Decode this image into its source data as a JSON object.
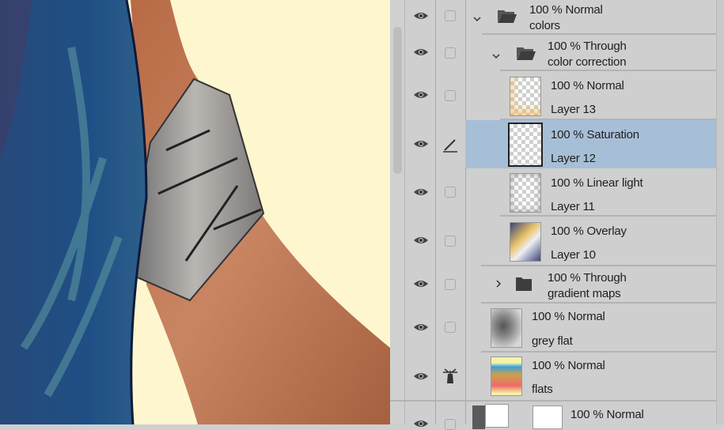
{
  "colors": {
    "selected_row": "#a7bfd6",
    "panel_bg": "#cfcfcf",
    "canvas_bg": "#fdf6cf"
  },
  "layers": [
    {
      "kind": "folder",
      "expanded": true,
      "blend": "100 % Normal",
      "name": "colors",
      "visible": true
    },
    {
      "kind": "folder",
      "expanded": true,
      "blend": "100 % Through",
      "name": "color correction",
      "visible": true
    },
    {
      "kind": "layer",
      "blend": "100 % Normal",
      "name": "Layer 13",
      "visible": true
    },
    {
      "kind": "layer",
      "blend": "100 % Saturation",
      "name": "Layer 12",
      "visible": true,
      "selected": true,
      "status_icon": "pen-icon"
    },
    {
      "kind": "layer",
      "blend": "100 % Linear light",
      "name": "Layer 11",
      "visible": true
    },
    {
      "kind": "layer",
      "blend": "100 % Overlay",
      "name": "Layer 10",
      "visible": true
    },
    {
      "kind": "folder",
      "expanded": false,
      "blend": "100 % Through",
      "name": "gradient maps",
      "visible": true
    },
    {
      "kind": "layer",
      "blend": "100 % Normal",
      "name": "grey flat",
      "visible": true
    },
    {
      "kind": "layer",
      "blend": "100 % Normal",
      "name": "flats",
      "visible": true,
      "status_icon": "reference-layer-icon"
    },
    {
      "kind": "adjustment",
      "blend": "100 % Normal",
      "name": "",
      "visible": true
    }
  ]
}
